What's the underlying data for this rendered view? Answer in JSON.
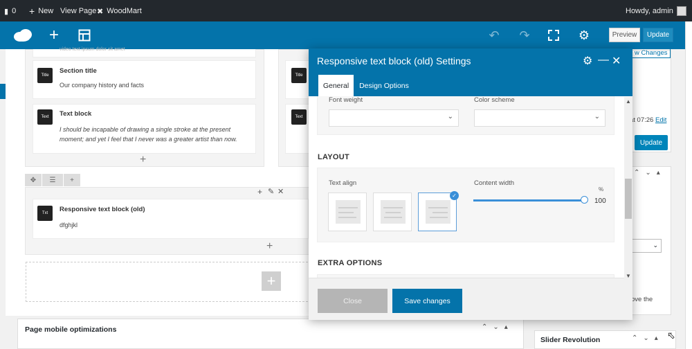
{
  "admin_bar": {
    "comments_count": "0",
    "new_label": "New",
    "view_page_label": "View Page",
    "woodmart_label": "WoodMart",
    "greeting": "Howdy, admin"
  },
  "builder_bar": {
    "preview_label": "Preview",
    "update_label": "Update"
  },
  "canvas": {
    "top_faded_text": "video text ipsum dolor sit amet",
    "elements": [
      {
        "title": "Section title",
        "text": "Our company history and facts",
        "icon_text": "Title"
      },
      {
        "title": "Text block",
        "text": "I should be incapable of drawing a single stroke at the present moment; and yet I feel that I never was a greater artist than now.",
        "icon_text": "Text"
      },
      {
        "title": "Responsive text block (old)",
        "text": "dfghjkl",
        "icon_text": "Txt"
      }
    ],
    "right_icons": [
      "Title",
      "Text"
    ]
  },
  "sidebar": {
    "changes_label": "w Changes",
    "publish_time": "at 07:26",
    "edit_link": "Edit",
    "update_label": "Update",
    "above_text": "ove the",
    "slider_revolution": "Slider Revolution"
  },
  "mobile_box": {
    "title": "Page mobile optimizations"
  },
  "modal": {
    "title": "Responsive text block (old) Settings",
    "tabs": [
      "General",
      "Design Options"
    ],
    "font_weight_label": "Font weight",
    "color_scheme_label": "Color scheme",
    "font_weight_value": "",
    "color_scheme_value": "",
    "layout_heading": "LAYOUT",
    "text_align_label": "Text align",
    "text_align_selected": "right",
    "content_width_label": "Content width",
    "content_width_unit": "%",
    "content_width_value": "100",
    "extra_heading": "EXTRA OPTIONS",
    "close_label": "Close",
    "save_label": "Save changes"
  },
  "colors": {
    "brand_blue": "#0473aa",
    "accent": "#3a8fd8",
    "admin_bar": "#23282d"
  }
}
